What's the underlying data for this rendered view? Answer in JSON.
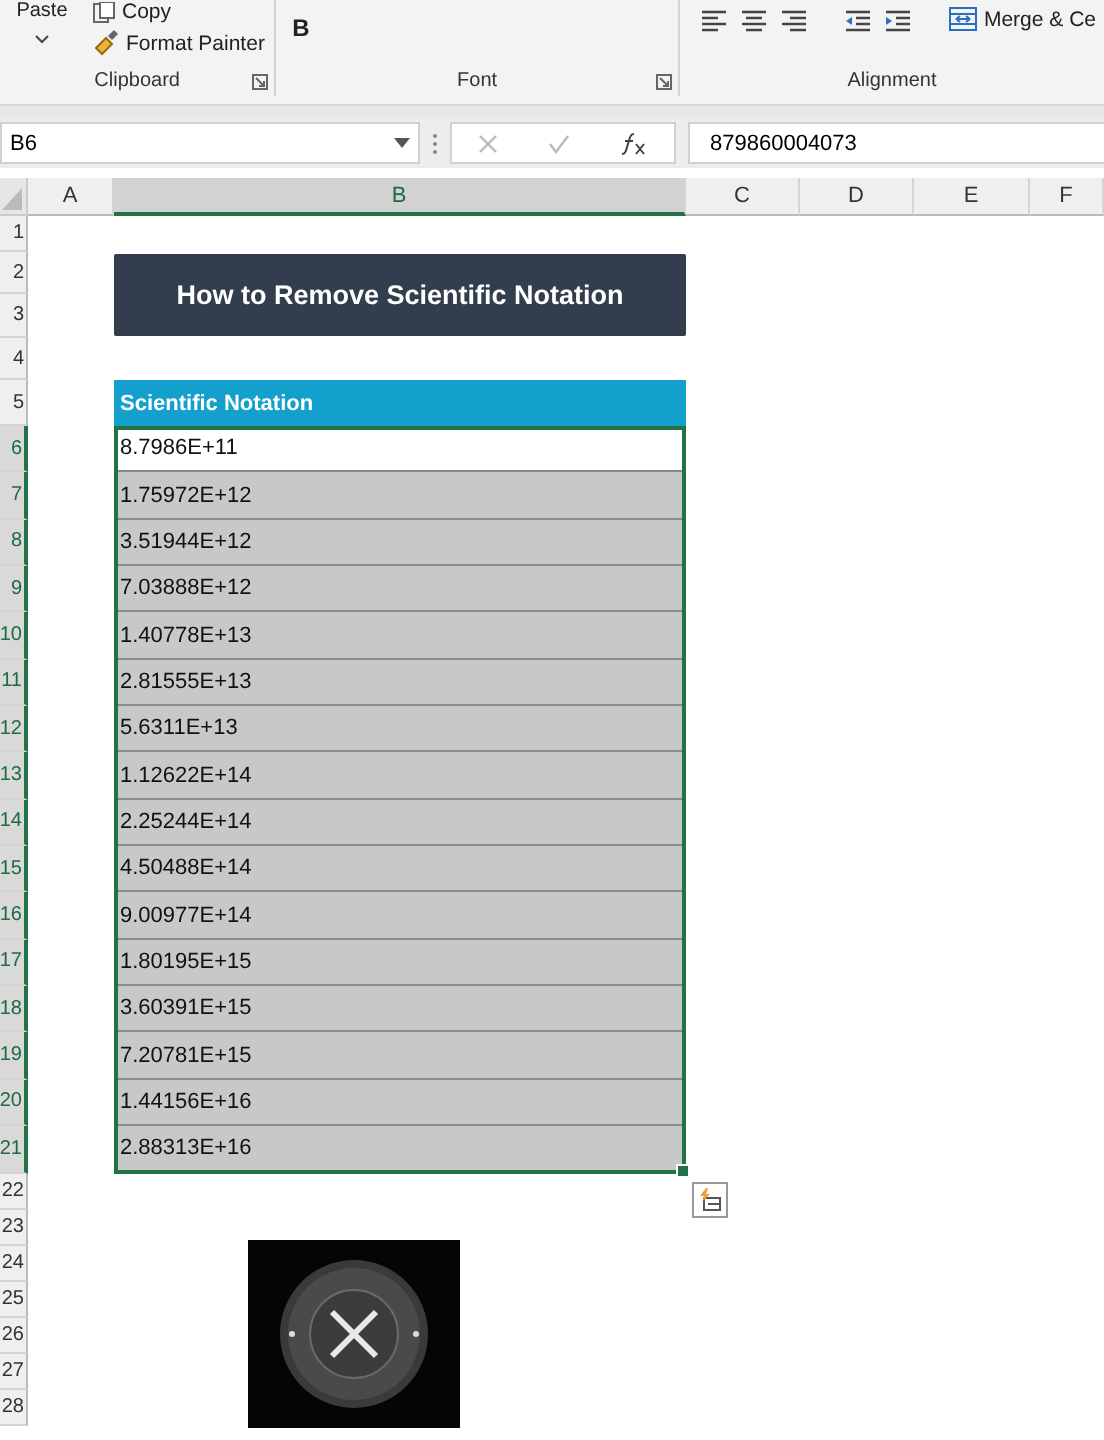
{
  "ribbon": {
    "clipboard": {
      "paste": "Paste",
      "copy": "Copy",
      "format_painter": "Format Painter",
      "label": "Clipboard"
    },
    "font": {
      "bold": "B",
      "label": "Font"
    },
    "alignment": {
      "merge": "Merge & Ce",
      "label": "Alignment"
    }
  },
  "formula_bar": {
    "name_box": "B6",
    "formula": "879860004073"
  },
  "columns": [
    {
      "label": "A",
      "selected": false
    },
    {
      "label": "B",
      "selected": true
    },
    {
      "label": "C",
      "selected": false
    },
    {
      "label": "D",
      "selected": false
    },
    {
      "label": "E",
      "selected": false
    },
    {
      "label": "F",
      "selected": false
    }
  ],
  "rows": [
    {
      "number": "1",
      "selected": false
    },
    {
      "number": "2",
      "selected": false
    },
    {
      "number": "3",
      "selected": false
    },
    {
      "number": "4",
      "selected": false
    },
    {
      "number": "5",
      "selected": false
    },
    {
      "number": "6",
      "selected": true
    },
    {
      "number": "7",
      "selected": true
    },
    {
      "number": "8",
      "selected": true
    },
    {
      "number": "9",
      "selected": true
    },
    {
      "number": "10",
      "selected": true
    },
    {
      "number": "11",
      "selected": true
    },
    {
      "number": "12",
      "selected": true
    },
    {
      "number": "13",
      "selected": true
    },
    {
      "number": "14",
      "selected": true
    },
    {
      "number": "15",
      "selected": true
    },
    {
      "number": "16",
      "selected": true
    },
    {
      "number": "17",
      "selected": true
    },
    {
      "number": "18",
      "selected": true
    },
    {
      "number": "19",
      "selected": true
    },
    {
      "number": "20",
      "selected": true
    },
    {
      "number": "21",
      "selected": true
    },
    {
      "number": "22",
      "selected": false
    },
    {
      "number": "23",
      "selected": false
    },
    {
      "number": "24",
      "selected": false
    },
    {
      "number": "25",
      "selected": false
    },
    {
      "number": "26",
      "selected": false
    },
    {
      "number": "27",
      "selected": false
    },
    {
      "number": "28",
      "selected": false
    }
  ],
  "title": "How to Remove Scientific Notation",
  "table": {
    "header": "Scientific Notation",
    "cells": [
      {
        "value": "8.7986E+11",
        "selected": true,
        "active": true
      },
      {
        "value": "1.75972E+12",
        "selected": true,
        "active": false
      },
      {
        "value": "3.51944E+12",
        "selected": true,
        "active": false
      },
      {
        "value": "7.03888E+12",
        "selected": true,
        "active": false
      },
      {
        "value": "1.40778E+13",
        "selected": true,
        "active": false
      },
      {
        "value": "2.81555E+13",
        "selected": true,
        "active": false
      },
      {
        "value": "5.6311E+13",
        "selected": true,
        "active": false
      },
      {
        "value": "1.12622E+14",
        "selected": true,
        "active": false
      },
      {
        "value": "2.25244E+14",
        "selected": true,
        "active": false
      },
      {
        "value": "4.50488E+14",
        "selected": true,
        "active": false
      },
      {
        "value": "9.00977E+14",
        "selected": true,
        "active": false
      },
      {
        "value": "1.80195E+15",
        "selected": true,
        "active": false
      },
      {
        "value": "3.60391E+15",
        "selected": true,
        "active": false
      },
      {
        "value": "7.20781E+15",
        "selected": true,
        "active": false
      },
      {
        "value": "1.44156E+16",
        "selected": true,
        "active": false
      },
      {
        "value": "2.88313E+16",
        "selected": true,
        "active": false
      }
    ]
  }
}
